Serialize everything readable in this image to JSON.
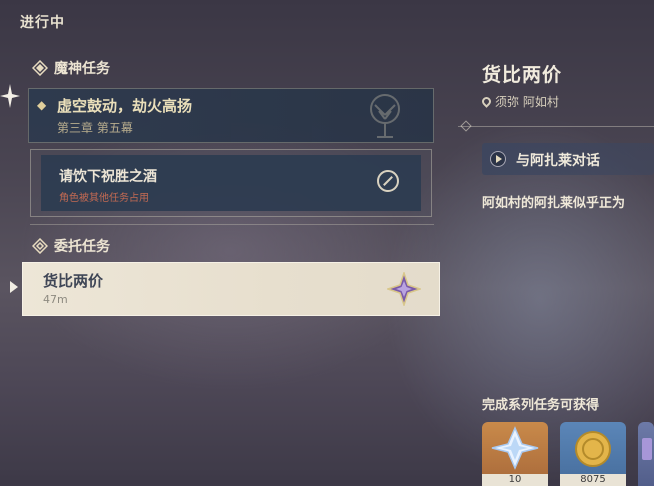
{
  "header": {
    "in_progress_label": "进行中"
  },
  "categories": {
    "archon": {
      "label": "魔神任务",
      "icon": "archon-quest-icon"
    },
    "commission": {
      "label": "委托任务",
      "icon": "commission-quest-icon"
    }
  },
  "archon_quest": {
    "title": "虚空鼓动，劫火高扬",
    "chapter": "第三章 第五幕"
  },
  "sub_quest": {
    "title": "请饮下祝胜之酒",
    "note": "角色被其他任务占用",
    "status_icon": "blocked-icon"
  },
  "selected_quest": {
    "title": "货比两价",
    "distance": "47m",
    "type_icon": "commission-star-icon"
  },
  "detail": {
    "title": "货比两价",
    "location": "须弥 阿如村",
    "objective": "与阿扎莱对话",
    "description": "阿如村的阿扎莱似乎正为",
    "rewards_label": "完成系列任务可获得",
    "rewards": [
      {
        "icon": "primogem-icon",
        "count": "10",
        "color": "#c98a4a"
      },
      {
        "icon": "mora-icon",
        "count": "8075",
        "color": "#5b86b8"
      },
      {
        "icon": "exp-book-icon",
        "count": "",
        "color": "#6d7aa8"
      }
    ]
  }
}
